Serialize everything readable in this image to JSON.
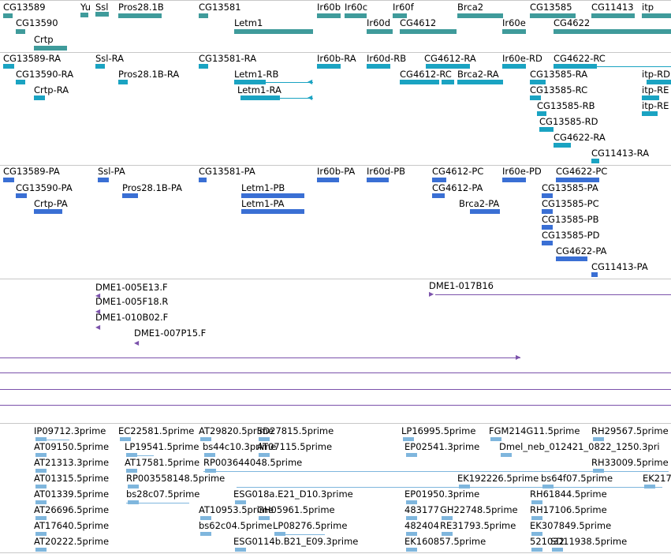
{
  "tracks": {
    "genes": {
      "color": "#3f9b9b",
      "labels": [
        "CG13589",
        "Yu",
        "Ssl",
        "Pros28.1B",
        "CG13581",
        "Ir60b",
        "Ir60c",
        "Ir60f",
        "Brca2",
        "CG13585",
        "CG11413",
        "itp",
        "CG13590",
        "Letm1",
        "Ir60d",
        "CG4612",
        "Ir60e",
        "CG4622",
        "Crtp"
      ]
    },
    "transcripts_ra": {
      "color": "#1aa3c2",
      "labels": [
        "CG13589-RA",
        "Ssl-RA",
        "CG13581-RA",
        "Ir60b-RA",
        "Ir60d-RB",
        "CG4612-RA",
        "Ir60e-RD",
        "CG4622-RC",
        "CG13590-RA",
        "Pros28.1B-RA",
        "Letm1-RB",
        "CG4612-RC",
        "Brca2-RA",
        "CG13585-RA",
        "itp-RD",
        "Crtp-RA",
        "Letm1-RA",
        "CG13585-RC",
        "itp-RE",
        "CG13585-RB",
        "itp-RE",
        "CG13585-RD",
        "CG4622-RA",
        "CG11413-RA"
      ]
    },
    "transcripts_pa": {
      "color": "#3a6fd4",
      "labels": [
        "CG13589-PA",
        "Ssl-PA",
        "CG13581-PA",
        "Ir60b-PA",
        "Ir60d-PB",
        "CG4612-PC",
        "Ir60e-PD",
        "CG4622-PC",
        "CG13590-PA",
        "Pros28.1B-PA",
        "Letm1-PB",
        "CG4612-PA",
        "CG13585-PA",
        "Crtp-PA",
        "Letm1-PA",
        "Brca2-PA",
        "CG13585-PC",
        "CG13585-PB",
        "CG13585-PD",
        "CG4622-PA",
        "CG11413-PA"
      ]
    },
    "clones": {
      "color": "#7b52ab",
      "labels": [
        "DME1-005E13.F",
        "DME1-017B16",
        "DME1-005F18.R",
        "DME1-010B02.F",
        "DME1-007P15.F"
      ]
    },
    "ests": {
      "color": "#7fb6dd",
      "labels": [
        "IP09712.3prime",
        "EC22581.5prime",
        "AT29820.5prime",
        "SD27815.5prime",
        "LP16995.5prime",
        "FGM214G11.5prime",
        "RH29567.5prime",
        "AT09150.5prime",
        "LP19541.5prime",
        "bs44c10.3prime",
        "AT07115.5prime",
        "EP02541.3prime",
        "Dmel_neb_012421_0822_1250.3pri",
        "AT21313.3prime",
        "AT17581.5prime",
        "RP003644048.5prime",
        "RH33009.5prime",
        "AT01315.5prime",
        "RP003558148.5prime",
        "EK192226.5prime",
        "bs64f07.5prime",
        "EK217",
        "AT01339.5prime",
        "bs28c07.5prime",
        "ESG018a.E21_D10.3prime",
        "EP01950.3prime",
        "RH61844.5prime",
        "AT26696.5prime",
        "AT10953.5prime",
        "GH05961.5prime",
        "483177",
        "GH22748.5prime",
        "RH17106.5prime",
        "AT17640.5prime",
        "bs62c04.5prime",
        "LP08276.5prime",
        "482404",
        "RE31793.5prime",
        "EK307849.5prime",
        "AT20222.5prime",
        "ESG0114b.B21_E09.3prime",
        "EK160857.5prime",
        "521032",
        "SD11938.5prime"
      ]
    }
  }
}
